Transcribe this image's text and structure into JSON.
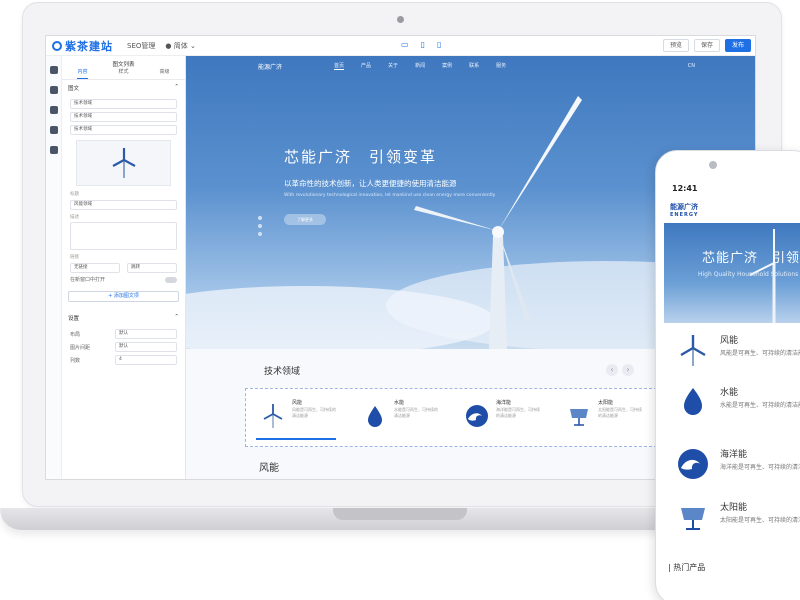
{
  "editor": {
    "app_name": "紫茶建站",
    "seo_label": "SEO管理",
    "language": "简体",
    "devices": [
      "desktop-icon",
      "tablet-icon",
      "mobile-icon"
    ],
    "actions": {
      "preview": "预览",
      "save": "保存",
      "publish": "发布"
    }
  },
  "panel": {
    "title": "图文列表",
    "tabs": [
      "内容",
      "样式",
      "高级"
    ],
    "section_1": "图文",
    "rows": [
      "技术领域",
      "技术领域",
      "技术领域"
    ],
    "field_title": "标题",
    "field_title_value": "风能领域",
    "field_desc": "描述",
    "field_link": "链接",
    "link_type": "无链接",
    "link_target": "跳转",
    "new_window_label": "在新窗口中打开",
    "add_button": "+ 添加图文项",
    "section_2": "设置",
    "layout_label": "布局",
    "layout_value": "默认",
    "spacing_label": "图片间距",
    "spacing_value": "默认",
    "columns_label": "列数",
    "columns_value": "4"
  },
  "site": {
    "logo": "能源广济",
    "nav": [
      "首页",
      "产品",
      "关于",
      "新闻",
      "案例",
      "联系",
      "服务"
    ],
    "lang": "CN",
    "hero_title": "芯能广济　引领变革",
    "hero_sub": "以革命性的技术创新，让人类更便捷的使用清洁能源",
    "hero_en": "With revolutionary technological innovation, let mankind use clean energy more conveniently",
    "hero_btn": "了解更多",
    "tech_title": "技术领域",
    "tech_items": [
      {
        "name": "风能",
        "desc": "风能是可再生、可持续的清洁能源"
      },
      {
        "name": "水能",
        "desc": "水能是可再生、可持续的清洁能源"
      },
      {
        "name": "海洋能",
        "desc": "海洋能是可再生、可持续的清洁能源"
      },
      {
        "name": "太阳能",
        "desc": "太阳能是可再生、可持续的清洁能源"
      }
    ],
    "wind_section": "风能"
  },
  "phone": {
    "time": "12:41",
    "logo": "能源广济",
    "logo_en": "ENERGY",
    "hero_title": "芯能广济　引领变",
    "hero_en": "High Quality Household Solutions",
    "items": [
      {
        "name": "风能",
        "desc": "风能是可再生、可持续的清洁能源"
      },
      {
        "name": "水能",
        "desc": "水能是可再生、可持续的清洁能源"
      },
      {
        "name": "海洋能",
        "desc": "海洋能是可再生、可持续的清洁能源"
      },
      {
        "name": "太阳能",
        "desc": "太阳能是可再生、可持续的清洁能源"
      }
    ],
    "hot_products": "| 热门产品"
  }
}
